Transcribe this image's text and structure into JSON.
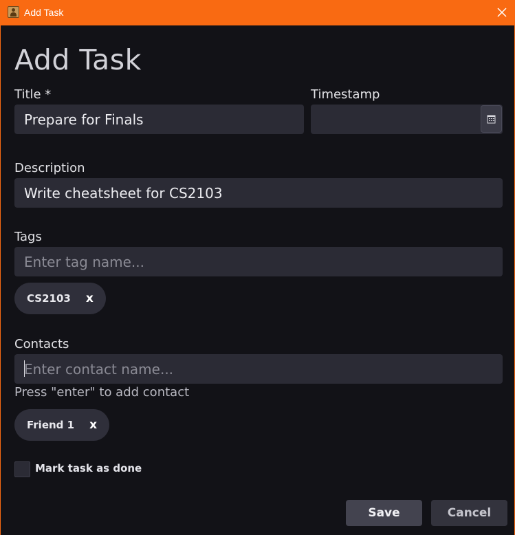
{
  "window": {
    "title": "Add Task",
    "accent_color": "#f96a12",
    "icons": {
      "app": "contact-book-icon",
      "close": "close-icon"
    }
  },
  "form": {
    "heading": "Add Task",
    "title_field": {
      "label": "Title *",
      "value": "Prepare for Finals"
    },
    "timestamp_field": {
      "label": "Timestamp",
      "value": "",
      "button_icon": "calendar-icon"
    },
    "description_field": {
      "label": "Description",
      "value": "Write cheatsheet for CS2103"
    },
    "tags_field": {
      "label": "Tags",
      "placeholder": "Enter tag name...",
      "chips": [
        {
          "label": "CS2103",
          "remove": "x"
        }
      ]
    },
    "contacts_field": {
      "label": "Contacts",
      "placeholder": "Enter contact name...",
      "helper": "Press \"enter\" to add contact",
      "chips": [
        {
          "label": "Friend 1",
          "remove": "x"
        }
      ]
    },
    "done_checkbox": {
      "label": "Mark task as done",
      "checked": false
    }
  },
  "actions": {
    "save": "Save",
    "cancel": "Cancel"
  }
}
